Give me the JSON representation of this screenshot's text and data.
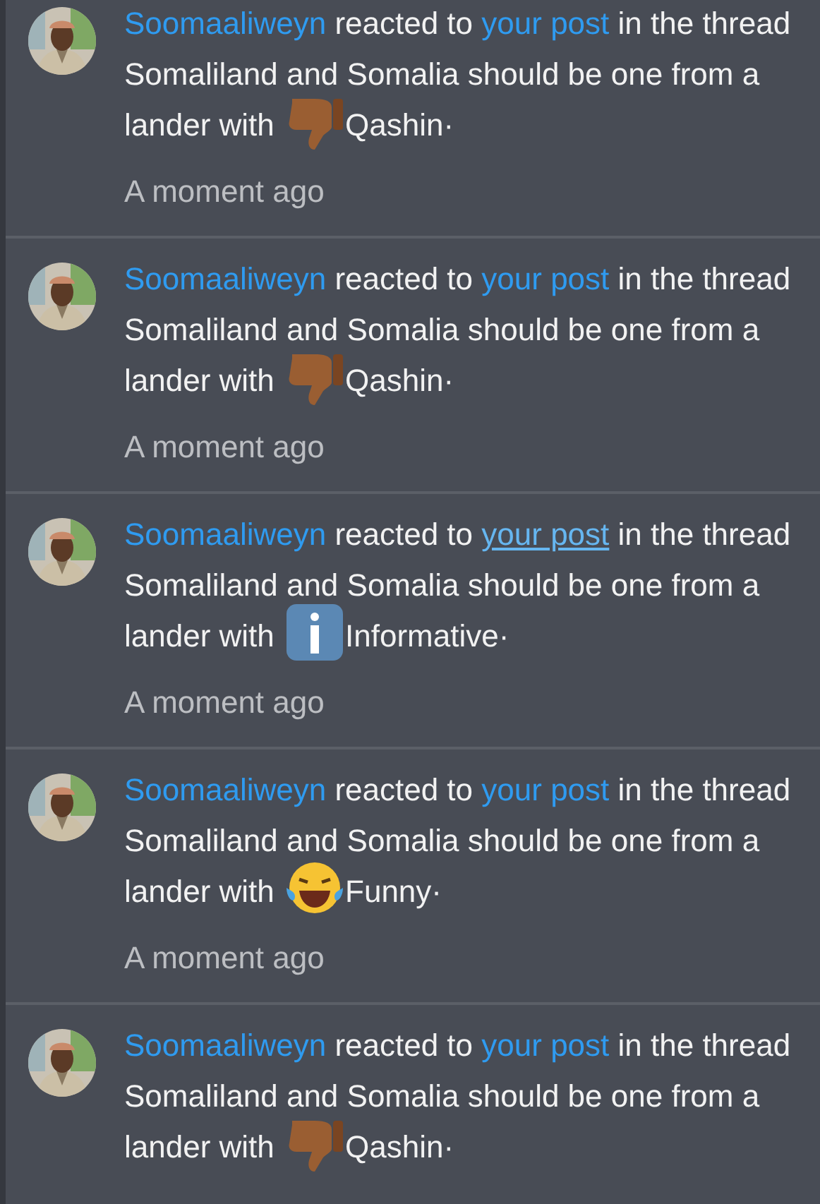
{
  "alerts": [
    {
      "user": "Soomaaliweyn",
      "verb": "reacted to",
      "link": {
        "text": "your post",
        "hovered": false
      },
      "message": "in the thread Somaliland and Somalia should be one from a lander with",
      "reaction": {
        "kind": "thumbs_down",
        "label": "Qashin·"
      },
      "time": "A moment ago"
    },
    {
      "user": "Soomaaliweyn",
      "verb": "reacted to",
      "link": {
        "text": "your post",
        "hovered": false
      },
      "message": "in the thread Somaliland and Somalia should be one from a lander with",
      "reaction": {
        "kind": "thumbs_down",
        "label": "Qashin·"
      },
      "time": "A moment ago"
    },
    {
      "user": "Soomaaliweyn",
      "verb": "reacted to",
      "link": {
        "text": "your post",
        "hovered": true
      },
      "message": "in the thread Somaliland and Somalia should be one from a lander with",
      "reaction": {
        "kind": "info",
        "label": "Informative·"
      },
      "time": "A moment ago"
    },
    {
      "user": "Soomaaliweyn",
      "verb": "reacted to",
      "link": {
        "text": "your post",
        "hovered": false
      },
      "message": "in the thread Somaliland and Somalia should be one from a lander with",
      "reaction": {
        "kind": "laugh",
        "label": "Funny·"
      },
      "time": "A moment ago"
    },
    {
      "user": "Soomaaliweyn",
      "verb": "reacted to",
      "link": {
        "text": "your post",
        "hovered": false
      },
      "message": "in the thread Somaliland and Somalia should be one from a lander with",
      "reaction": {
        "kind": "thumbs_down",
        "label": "Qashin·"
      }
    }
  ]
}
